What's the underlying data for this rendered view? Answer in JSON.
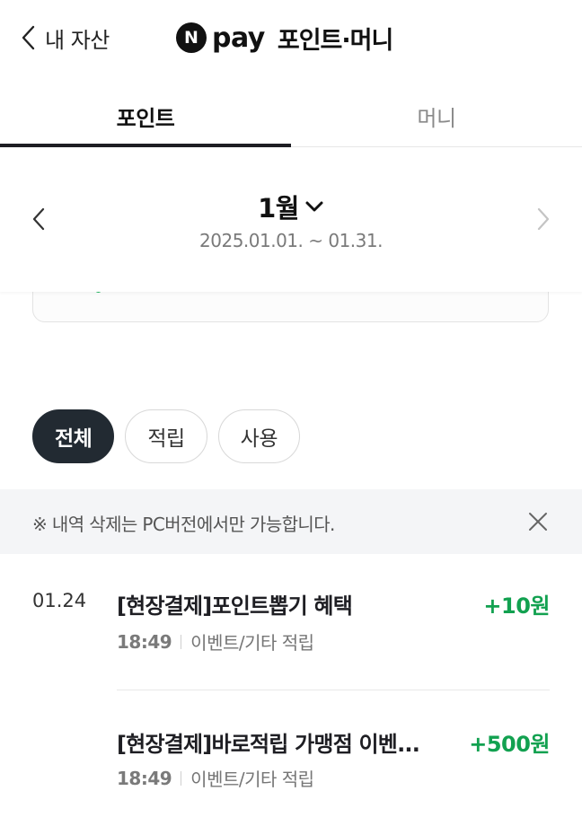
{
  "header": {
    "back_label": "내 자산",
    "logo_letter": "N",
    "pay_label": "pay",
    "title": "포인트·머니"
  },
  "tabs": [
    {
      "label": "포인트",
      "active": true
    },
    {
      "label": "머니",
      "active": false
    }
  ],
  "period": {
    "month": "1월",
    "range": "2025.01.01. ~ 01.31."
  },
  "filters": [
    {
      "label": "전체",
      "active": true
    },
    {
      "label": "적립",
      "active": false
    },
    {
      "label": "사용",
      "active": false
    }
  ],
  "notice": {
    "text": "※ 내역 삭제는 PC버전에서만 가능합니다."
  },
  "transactions": [
    {
      "date": "01.24",
      "title": "[현장결제]포인트뽑기 혜택",
      "time": "18:49",
      "category": "이벤트/기타 적립",
      "amount": "+10원"
    },
    {
      "date": "",
      "title": "[현장결제]바로적립 가맹점 이벤...",
      "time": "18:49",
      "category": "이벤트/기타 적립",
      "amount": "+500원"
    }
  ],
  "colors": {
    "accent_green": "#12a150",
    "active_chip": "#222a32",
    "text_dark": "#1e1e23"
  }
}
